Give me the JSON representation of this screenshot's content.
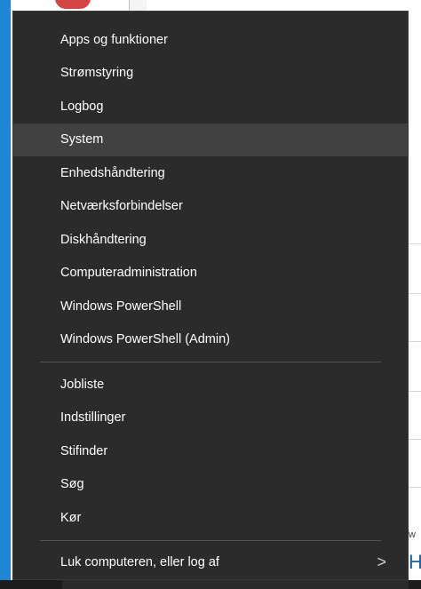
{
  "menu": {
    "groups": [
      {
        "items": [
          {
            "label": "Apps og funktioner"
          },
          {
            "label": "Strømstyring"
          },
          {
            "label": "Logbog"
          },
          {
            "label": "System",
            "highlighted": true
          },
          {
            "label": "Enhedshåndtering"
          },
          {
            "label": "Netværksforbindelser"
          },
          {
            "label": "Diskhåndtering"
          },
          {
            "label": "Computeradministration"
          },
          {
            "label": "Windows PowerShell"
          },
          {
            "label": "Windows PowerShell (Admin)"
          }
        ]
      },
      {
        "items": [
          {
            "label": "Jobliste"
          },
          {
            "label": "Indstillinger"
          },
          {
            "label": "Stifinder"
          },
          {
            "label": "Søg"
          },
          {
            "label": "Kør"
          }
        ]
      },
      {
        "items": [
          {
            "label": "Luk computeren, eller log af",
            "submenu_glyph": ">"
          }
        ]
      }
    ]
  },
  "background": {
    "right_text": "w",
    "right_link": "H"
  },
  "colors": {
    "menu_bg": "#2b2b2b",
    "highlight_bg": "#414141",
    "text": "#ffffff",
    "separator": "#555555",
    "accent_strip": "#1f86d6"
  }
}
